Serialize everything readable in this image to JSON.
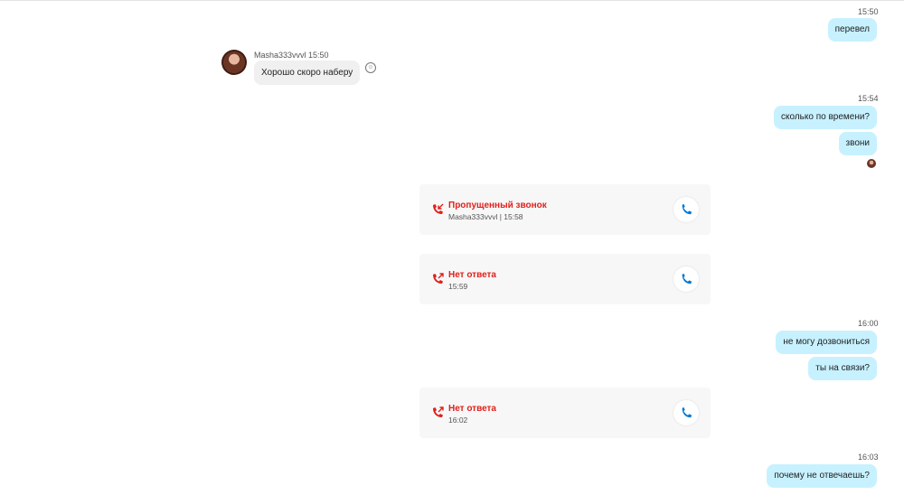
{
  "messages": {
    "ts1": "15:50",
    "out1": "перевел",
    "sender_line": "Masha333vvvl 15:50",
    "in1": "Хорошо скоро наберу",
    "emoji_glyph": "☺",
    "ts2": "15:54",
    "out2": "сколько по времени?",
    "out3": "звони",
    "ts3": "16:00",
    "out4": "не могу дозвониться",
    "out5": "ты на связи?",
    "ts4": "16:03",
    "out6": "почему не отвечаешь?"
  },
  "calls": [
    {
      "title": "Пропущенный звонок",
      "sub": "Masha333vvvl | 15:58",
      "icon": "missed-call-icon"
    },
    {
      "title": "Нет ответа",
      "sub": "15:59",
      "icon": "outgoing-call-icon"
    },
    {
      "title": "Нет ответа",
      "sub": "16:02",
      "icon": "outgoing-call-icon"
    }
  ],
  "colors": {
    "outgoing_bubble": "#c7f1ff",
    "incoming_bubble": "#f0f0f0",
    "call_red": "#e0201a",
    "call_blue": "#0078d4"
  }
}
